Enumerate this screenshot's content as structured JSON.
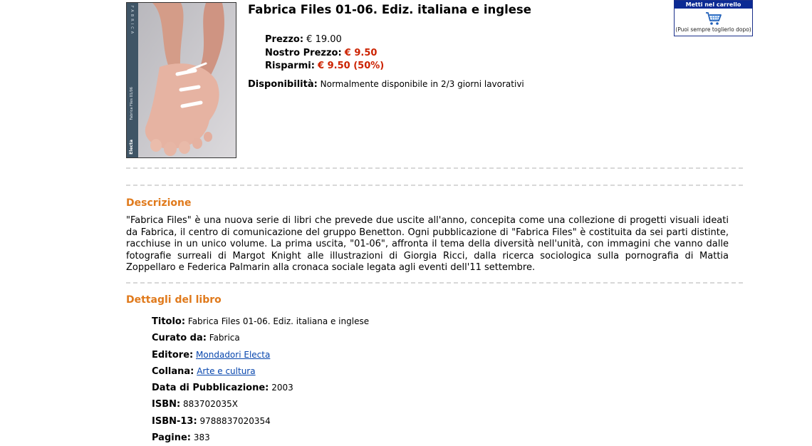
{
  "product": {
    "title": "Fabrica Files 01-06. Ediz. italiana e inglese",
    "cover": {
      "spine_top": "FABRICA",
      "spine_title": "Fabrica Files 01/06",
      "spine_publisher": "Electa"
    },
    "price": {
      "label": "Prezzo:",
      "value": "€ 19.00"
    },
    "our_price": {
      "label": "Nostro Prezzo:",
      "value": "€ 9.50"
    },
    "savings": {
      "label": "Risparmi:",
      "value": "€ 9.50 (50%)"
    },
    "availability": {
      "label": "Disponibilità:",
      "value": "Normalmente disponibile in 2/3 giorni lavorativi"
    }
  },
  "cart": {
    "header": "Metti nel carrello",
    "note": "(Puoi sempre toglierlo dopo)",
    "icon": "shopping-cart-icon"
  },
  "description": {
    "heading": "Descrizione",
    "text": "\"Fabrica Files\" è una nuova serie di libri che prevede due uscite all'anno, concepita come una collezione di progetti visuali ideati da Fabrica, il centro di comunicazione del gruppo Benetton. Ogni pubblicazione di \"Fabrica Files\" è costituita da sei parti distinte, racchiuse in un unico volume. La prima uscita, \"01-06\", affronta il tema della diversità nell'unità, con immagini che vanno dalle fotografie surreali di Margot Knight alle illustrazioni di Giorgia Ricci, dalla ricerca sociologica sulla pornografia di Mattia Zoppellaro e Federica Palmarin alla cronaca sociale legata agli eventi dell'11 settembre."
  },
  "details": {
    "heading": "Dettagli del libro",
    "rows": [
      {
        "label": "Titolo:",
        "value": "Fabrica Files 01-06. Ediz. italiana e inglese"
      },
      {
        "label": "Curato da:",
        "value": "Fabrica"
      },
      {
        "label": "Editore:",
        "value": "Mondadori Electa"
      },
      {
        "label": "Collana:",
        "value": "Arte e cultura"
      },
      {
        "label": "Data di Pubblicazione:",
        "value": "2003"
      },
      {
        "label": "ISBN:",
        "value": "883702035X"
      },
      {
        "label": "ISBN-13:",
        "value": "9788837020354"
      },
      {
        "label": "Pagine:",
        "value": "383"
      }
    ]
  },
  "colors": {
    "accent_orange": "#e07a1c",
    "price_red": "#cc2200",
    "cart_blue": "#0b2a94",
    "link_blue": "#0645ad"
  }
}
